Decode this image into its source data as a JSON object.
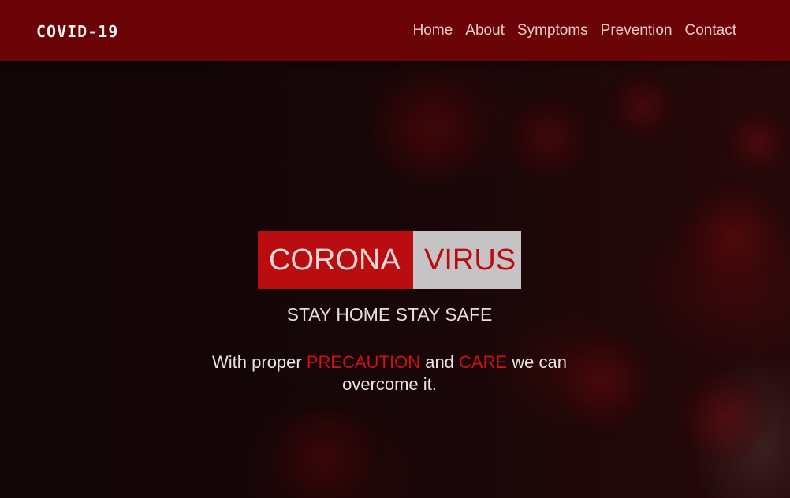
{
  "brand": {
    "name": "COVID-19"
  },
  "nav": {
    "links": [
      {
        "label": "Home"
      },
      {
        "label": "About"
      },
      {
        "label": "Symptoms"
      },
      {
        "label": "Prevention"
      },
      {
        "label": "Contact"
      }
    ]
  },
  "hero": {
    "title_part1": "CORONA",
    "title_part2": "VIRUS",
    "tagline": "STAY HOME STAY SAFE",
    "message": {
      "prefix": "With proper ",
      "highlight1": "PRECAUTION",
      "middle": " and ",
      "highlight2": "CARE",
      "suffix": " we can overcome it."
    }
  },
  "colors": {
    "navbar": "#6b0406",
    "accent_red": "#b90d0f",
    "accent_grey": "#c5c3c3",
    "background": "#140708"
  }
}
